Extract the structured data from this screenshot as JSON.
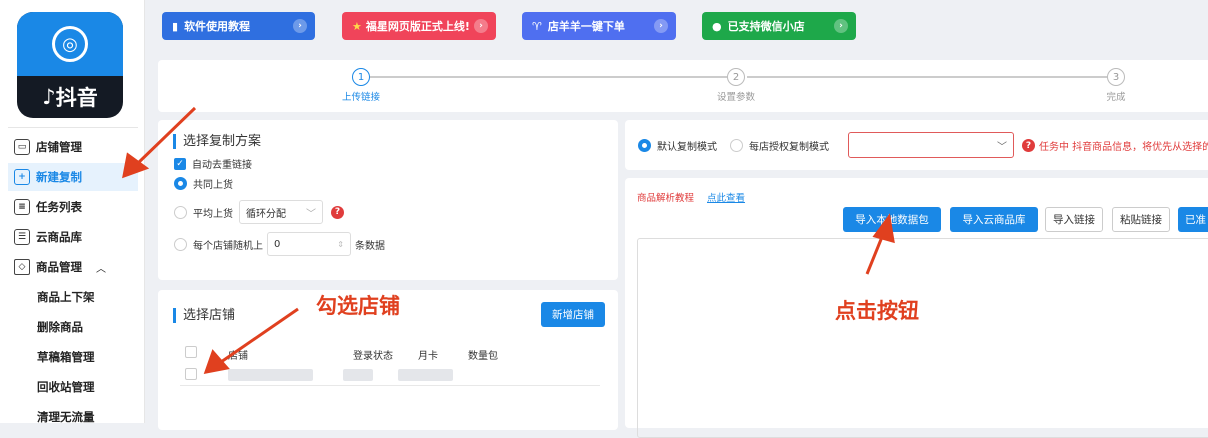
{
  "logo": {
    "brand_text": "抖音",
    "coin_glyph": "◎"
  },
  "sidebar": {
    "items": [
      {
        "label": "店铺管理",
        "icon": "store-icon"
      },
      {
        "label": "新建复制",
        "icon": "add-copy-icon"
      },
      {
        "label": "任务列表",
        "icon": "task-list-icon"
      },
      {
        "label": "云商品库",
        "icon": "cloud-library-icon"
      },
      {
        "label": "商品管理",
        "icon": "cube-icon"
      },
      {
        "label": "商品上下架"
      },
      {
        "label": "删除商品"
      },
      {
        "label": "草稿箱管理"
      },
      {
        "label": "回收站管理"
      },
      {
        "label": "清理无流量"
      }
    ]
  },
  "topbar": {
    "buttons": [
      {
        "label": "软件使用教程",
        "color": "#2f6fe0"
      },
      {
        "label": "福星网页版正式上线!",
        "color": "#f0445a"
      },
      {
        "label": "店羊羊一键下单",
        "color": "#4f6ff0"
      },
      {
        "label": "已支持微信小店",
        "color": "#1ea84a"
      }
    ]
  },
  "steps": [
    {
      "num": "1",
      "label": "上传链接"
    },
    {
      "num": "2",
      "label": "设置参数"
    },
    {
      "num": "3",
      "label": "完成"
    }
  ],
  "copy_plan": {
    "title": "选择复制方案",
    "dedup_label": "自动去重链接",
    "shared_label": "共同上货",
    "avg_label": "平均上货",
    "avg_select": "循环分配",
    "random_prefix": "每个店铺随机上",
    "random_value": "0",
    "random_suffix": "条数据"
  },
  "shops": {
    "title": "选择店铺",
    "add_button": "新增店铺",
    "columns": [
      "店铺",
      "登录状态",
      "月卡",
      "数量包"
    ]
  },
  "mode": {
    "default_label": "默认复制模式",
    "auth_label": "每店授权复制模式",
    "tip": "任务中 抖音商品信息，将优先从选择的"
  },
  "parse": {
    "tutorial": "商品解析教程",
    "view_link": "点此查看",
    "buttons": [
      "导入本地数据包",
      "导入云商品库",
      "导入链接",
      "粘贴链接",
      "已准"
    ]
  },
  "annotations": {
    "check_shop": "勾选店铺",
    "click_button": "点击按钮"
  },
  "colors": {
    "accent": "#1a88e6",
    "annotation": "#e0401f"
  }
}
